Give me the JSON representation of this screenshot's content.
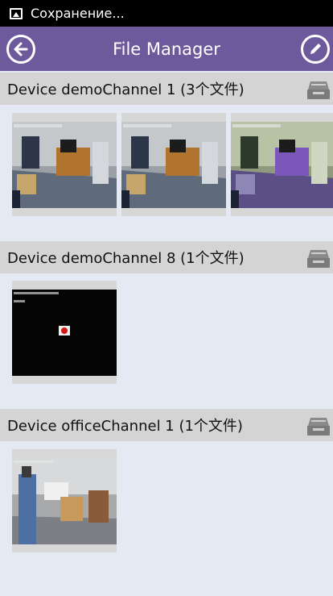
{
  "status_bar": {
    "text": "Сохранение..."
  },
  "app_bar": {
    "title": "File Manager",
    "back_icon": "back-arrow-icon",
    "edit_icon": "pencil-icon"
  },
  "sections": [
    {
      "title": "Device demoChannel 1 (3个文件)",
      "icon": "tray-icon"
    },
    {
      "title": "Device demoChannel 8 (1个文件)",
      "icon": "tray-icon"
    },
    {
      "title": "Device officeChannel 1 (1个文件)",
      "icon": "tray-icon"
    }
  ],
  "colors": {
    "app_bar": "#6d5a9d",
    "background": "#e4e9f4",
    "section_header": "#d4d4d4"
  }
}
